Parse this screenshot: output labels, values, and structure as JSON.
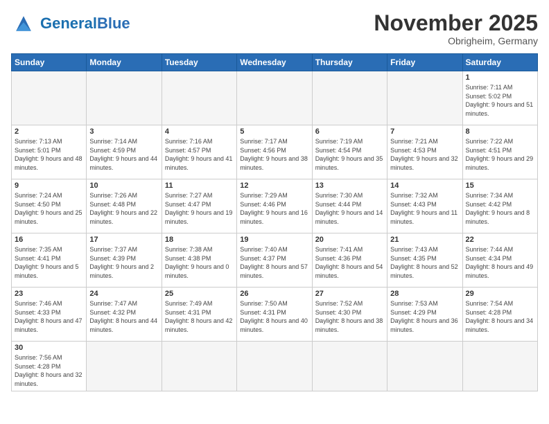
{
  "header": {
    "logo_general": "General",
    "logo_blue": "Blue",
    "month_title": "November 2025",
    "location": "Obrigheim, Germany"
  },
  "weekdays": [
    "Sunday",
    "Monday",
    "Tuesday",
    "Wednesday",
    "Thursday",
    "Friday",
    "Saturday"
  ],
  "weeks": [
    [
      {
        "day": "",
        "empty": true
      },
      {
        "day": "",
        "empty": true
      },
      {
        "day": "",
        "empty": true
      },
      {
        "day": "",
        "empty": true
      },
      {
        "day": "",
        "empty": true
      },
      {
        "day": "",
        "empty": true
      },
      {
        "day": "1",
        "sunrise": "7:11 AM",
        "sunset": "5:02 PM",
        "daylight": "9 hours and 51 minutes."
      }
    ],
    [
      {
        "day": "2",
        "sunrise": "7:13 AM",
        "sunset": "5:01 PM",
        "daylight": "9 hours and 48 minutes."
      },
      {
        "day": "3",
        "sunrise": "7:14 AM",
        "sunset": "4:59 PM",
        "daylight": "9 hours and 44 minutes."
      },
      {
        "day": "4",
        "sunrise": "7:16 AM",
        "sunset": "4:57 PM",
        "daylight": "9 hours and 41 minutes."
      },
      {
        "day": "5",
        "sunrise": "7:17 AM",
        "sunset": "4:56 PM",
        "daylight": "9 hours and 38 minutes."
      },
      {
        "day": "6",
        "sunrise": "7:19 AM",
        "sunset": "4:54 PM",
        "daylight": "9 hours and 35 minutes."
      },
      {
        "day": "7",
        "sunrise": "7:21 AM",
        "sunset": "4:53 PM",
        "daylight": "9 hours and 32 minutes."
      },
      {
        "day": "8",
        "sunrise": "7:22 AM",
        "sunset": "4:51 PM",
        "daylight": "9 hours and 29 minutes."
      }
    ],
    [
      {
        "day": "9",
        "sunrise": "7:24 AM",
        "sunset": "4:50 PM",
        "daylight": "9 hours and 25 minutes."
      },
      {
        "day": "10",
        "sunrise": "7:26 AM",
        "sunset": "4:48 PM",
        "daylight": "9 hours and 22 minutes."
      },
      {
        "day": "11",
        "sunrise": "7:27 AM",
        "sunset": "4:47 PM",
        "daylight": "9 hours and 19 minutes."
      },
      {
        "day": "12",
        "sunrise": "7:29 AM",
        "sunset": "4:46 PM",
        "daylight": "9 hours and 16 minutes."
      },
      {
        "day": "13",
        "sunrise": "7:30 AM",
        "sunset": "4:44 PM",
        "daylight": "9 hours and 14 minutes."
      },
      {
        "day": "14",
        "sunrise": "7:32 AM",
        "sunset": "4:43 PM",
        "daylight": "9 hours and 11 minutes."
      },
      {
        "day": "15",
        "sunrise": "7:34 AM",
        "sunset": "4:42 PM",
        "daylight": "9 hours and 8 minutes."
      }
    ],
    [
      {
        "day": "16",
        "sunrise": "7:35 AM",
        "sunset": "4:41 PM",
        "daylight": "9 hours and 5 minutes."
      },
      {
        "day": "17",
        "sunrise": "7:37 AM",
        "sunset": "4:39 PM",
        "daylight": "9 hours and 2 minutes."
      },
      {
        "day": "18",
        "sunrise": "7:38 AM",
        "sunset": "4:38 PM",
        "daylight": "9 hours and 0 minutes."
      },
      {
        "day": "19",
        "sunrise": "7:40 AM",
        "sunset": "4:37 PM",
        "daylight": "8 hours and 57 minutes."
      },
      {
        "day": "20",
        "sunrise": "7:41 AM",
        "sunset": "4:36 PM",
        "daylight": "8 hours and 54 minutes."
      },
      {
        "day": "21",
        "sunrise": "7:43 AM",
        "sunset": "4:35 PM",
        "daylight": "8 hours and 52 minutes."
      },
      {
        "day": "22",
        "sunrise": "7:44 AM",
        "sunset": "4:34 PM",
        "daylight": "8 hours and 49 minutes."
      }
    ],
    [
      {
        "day": "23",
        "sunrise": "7:46 AM",
        "sunset": "4:33 PM",
        "daylight": "8 hours and 47 minutes."
      },
      {
        "day": "24",
        "sunrise": "7:47 AM",
        "sunset": "4:32 PM",
        "daylight": "8 hours and 44 minutes."
      },
      {
        "day": "25",
        "sunrise": "7:49 AM",
        "sunset": "4:31 PM",
        "daylight": "8 hours and 42 minutes."
      },
      {
        "day": "26",
        "sunrise": "7:50 AM",
        "sunset": "4:31 PM",
        "daylight": "8 hours and 40 minutes."
      },
      {
        "day": "27",
        "sunrise": "7:52 AM",
        "sunset": "4:30 PM",
        "daylight": "8 hours and 38 minutes."
      },
      {
        "day": "28",
        "sunrise": "7:53 AM",
        "sunset": "4:29 PM",
        "daylight": "8 hours and 36 minutes."
      },
      {
        "day": "29",
        "sunrise": "7:54 AM",
        "sunset": "4:28 PM",
        "daylight": "8 hours and 34 minutes."
      }
    ],
    [
      {
        "day": "30",
        "sunrise": "7:56 AM",
        "sunset": "4:28 PM",
        "daylight": "8 hours and 32 minutes.",
        "last": true
      },
      {
        "day": "",
        "empty": true,
        "last": true
      },
      {
        "day": "",
        "empty": true,
        "last": true
      },
      {
        "day": "",
        "empty": true,
        "last": true
      },
      {
        "day": "",
        "empty": true,
        "last": true
      },
      {
        "day": "",
        "empty": true,
        "last": true
      },
      {
        "day": "",
        "empty": true,
        "last": true
      }
    ]
  ]
}
